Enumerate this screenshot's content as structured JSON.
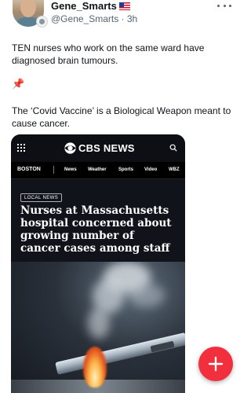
{
  "post": {
    "author": {
      "display_name": "Gene_Smarts",
      "flag_icon": "us-flag-icon",
      "handle": "@Gene_Smarts",
      "time_ago": "3h",
      "handle_line": "@Gene_Smarts · 3h"
    },
    "text_1": "TEN nurses who work on the same ward have diagnosed brain tumours.",
    "pin_icon": "pushpin-icon",
    "text_2": "The ‘Covid Vaccine’ is a Biological Weapon meant to cause cancer."
  },
  "media": {
    "brand": "CBS NEWS",
    "nav": {
      "city": "BOSTON",
      "items": [
        "News",
        "Weather",
        "Sports",
        "Video",
        "WBZ"
      ]
    },
    "tag": "LOCAL NEWS",
    "headline": "Nurses at Massachusetts hospital concerned about growing number of cancer cases among staff"
  },
  "fab": {
    "icon": "plus-icon"
  },
  "colors": {
    "fab": "#f2303d",
    "media_bg": "#11131a",
    "handle": "#536471"
  }
}
